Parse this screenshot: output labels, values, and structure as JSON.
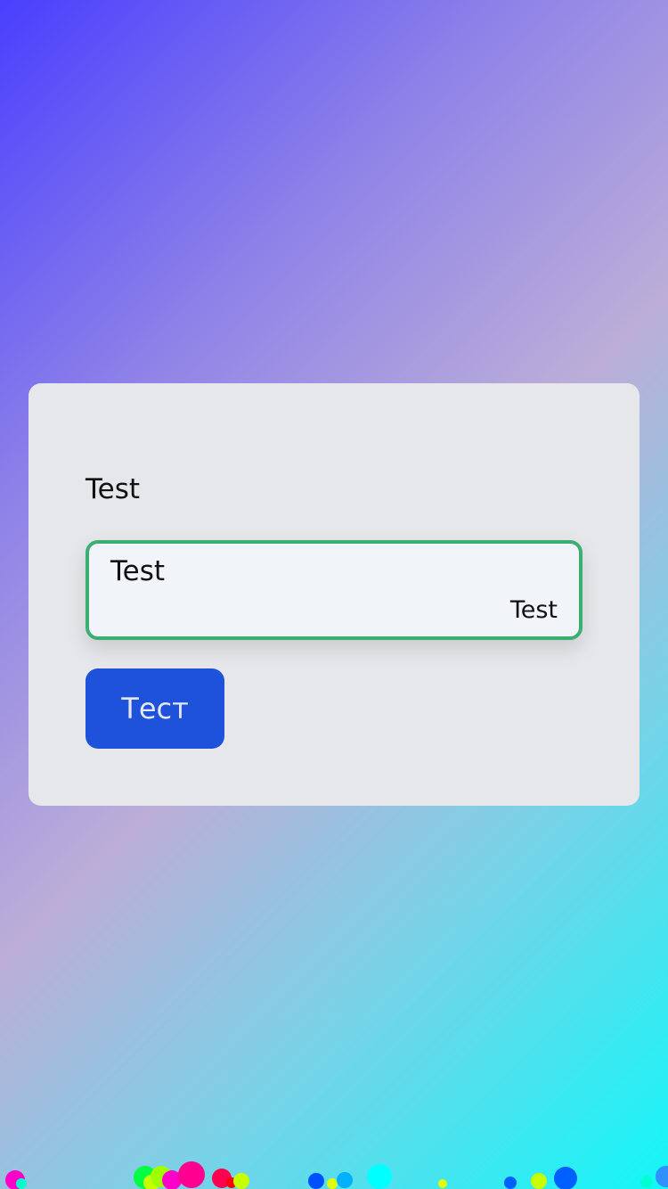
{
  "card": {
    "label": "Test",
    "input": {
      "value": "Test",
      "hint": "Test"
    },
    "button_label": "Тест"
  },
  "colors": {
    "gradient_start": "#4a3ffe",
    "gradient_mid": "#bcaed8",
    "gradient_end": "#12f7f8",
    "card_background": "#e6e7ea",
    "input_border": "#3dae72",
    "input_background": "#f1f4f8",
    "button_background": "#1f52da",
    "button_text": "#e4e7f2",
    "confetti": [
      "#ff00c8",
      "#00ffcc",
      "#00ff44",
      "#c8ff00",
      "#a0ff00",
      "#ff0090",
      "#ff0050",
      "#ff0000",
      "#0050ff",
      "#00b0ff",
      "#00ffff",
      "#e0ff00",
      "#0060ff",
      "#00ffd0",
      "#3090ff"
    ]
  }
}
